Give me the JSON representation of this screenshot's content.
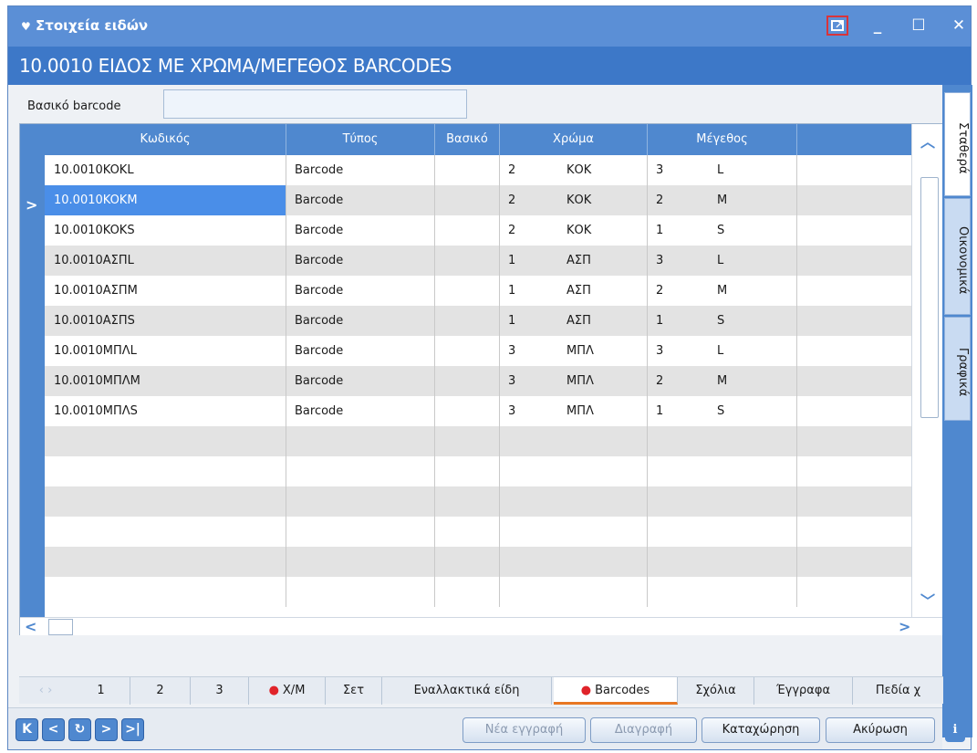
{
  "window": {
    "title": "Στοιχεία ειδών",
    "bullet": "♥"
  },
  "record": {
    "title": "10.0010 ΕΙΔΟΣ ΜΕ ΧΡΩΜΑ/ΜΕΓΕΘΟΣ BARCODES"
  },
  "basic_barcode": {
    "label": "Βασικό barcode",
    "value": ""
  },
  "grid": {
    "columns": [
      "Κωδικός",
      "Τύπος",
      "Βασικό",
      "Χρώμα",
      "Μέγεθος"
    ],
    "rows": [
      {
        "code": "10.0010KOKL",
        "type": "Barcode",
        "basic": "",
        "color_code": "2",
        "color": "ΚΟΚ",
        "size_code": "3",
        "size": "L"
      },
      {
        "code": "10.0010KOKM",
        "type": "Barcode",
        "basic": "",
        "color_code": "2",
        "color": "ΚΟΚ",
        "size_code": "2",
        "size": "M"
      },
      {
        "code": "10.0010KOKS",
        "type": "Barcode",
        "basic": "",
        "color_code": "2",
        "color": "ΚΟΚ",
        "size_code": "1",
        "size": "S"
      },
      {
        "code": "10.0010ΑΣΠL",
        "type": "Barcode",
        "basic": "",
        "color_code": "1",
        "color": "ΑΣΠ",
        "size_code": "3",
        "size": "L"
      },
      {
        "code": "10.0010ΑΣΠΜ",
        "type": "Barcode",
        "basic": "",
        "color_code": "1",
        "color": "ΑΣΠ",
        "size_code": "2",
        "size": "M"
      },
      {
        "code": "10.0010ΑΣΠS",
        "type": "Barcode",
        "basic": "",
        "color_code": "1",
        "color": "ΑΣΠ",
        "size_code": "1",
        "size": "S"
      },
      {
        "code": "10.0010ΜΠΛL",
        "type": "Barcode",
        "basic": "",
        "color_code": "3",
        "color": "ΜΠΛ",
        "size_code": "3",
        "size": "L"
      },
      {
        "code": "10.0010ΜΠΛΜ",
        "type": "Barcode",
        "basic": "",
        "color_code": "3",
        "color": "ΜΠΛ",
        "size_code": "2",
        "size": "M"
      },
      {
        "code": "10.0010ΜΠΛS",
        "type": "Barcode",
        "basic": "",
        "color_code": "3",
        "color": "ΜΠΛ",
        "size_code": "1",
        "size": "S"
      }
    ],
    "selected_row": 1,
    "row_indicator": ">"
  },
  "side_tabs": [
    "Σταθερά",
    "Οικονομικά",
    "Γραφικά"
  ],
  "bottom_tabs": {
    "items": [
      {
        "label": "1",
        "dot": false
      },
      {
        "label": "2",
        "dot": false
      },
      {
        "label": "3",
        "dot": false
      },
      {
        "label": "Χ/Μ",
        "dot": true
      },
      {
        "label": "Σετ",
        "dot": false
      },
      {
        "label": "Εναλλακτικά είδη",
        "dot": false
      },
      {
        "label": "Barcodes",
        "dot": true
      },
      {
        "label": "Σχόλια",
        "dot": false
      },
      {
        "label": "Έγγραφα",
        "dot": false
      },
      {
        "label": "Πεδία χ",
        "dot": false
      }
    ],
    "active": "Barcodes"
  },
  "toolbar": {
    "new_record": "Νέα εγγραφή",
    "delete": "Διαγραφή",
    "save": "Καταχώρηση",
    "cancel": "Ακύρωση",
    "info": "i"
  },
  "colors": {
    "title_bar": "#5b8fd6",
    "record_bar": "#3d78c8",
    "header": "#4f88cf",
    "selection": "#4a8ee8",
    "active_tab_underline": "#e87722",
    "required_dot": "#e0232a"
  },
  "icons": [
    "detach-window-icon",
    "minimize-icon",
    "maximize-icon",
    "close-icon",
    "first-record-icon",
    "previous-record-icon",
    "refresh-icon",
    "next-record-icon",
    "last-record-icon",
    "info-icon"
  ]
}
